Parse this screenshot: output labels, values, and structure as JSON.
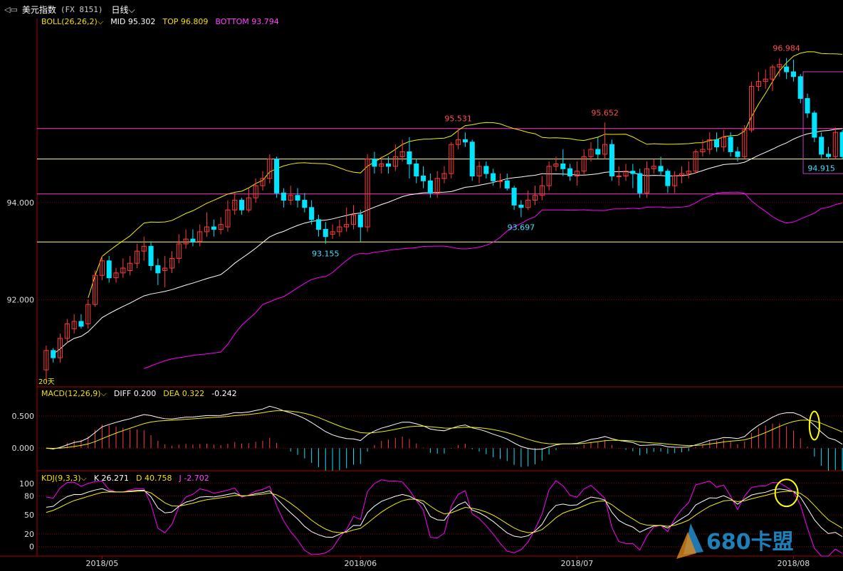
{
  "header": {
    "title": "美元指数",
    "code": "(FX 8151)",
    "period": "日线"
  },
  "colors": {
    "background": "#000000",
    "up": "#ff3b3b",
    "down": "#00e5ff",
    "mid": "#ffffff",
    "top": "#f0f000",
    "bottom": "#ff00ff",
    "hline_magenta": "#ff3cc8",
    "hline_yellow": "#ffff80",
    "grid": "#8a0000"
  },
  "boll": {
    "name": "BOLL(26,26,2)",
    "mid": "MID 95.302",
    "top": "TOP 96.809",
    "bottom": "BOTTOM 93.794"
  },
  "macd": {
    "name": "MACD(12,26,9)",
    "diff": "DIFF 0.200",
    "dea": "DEA 0.322",
    "macd": "-0.242"
  },
  "kdj": {
    "name": "KDJ(9,3,3)",
    "k": "K 26.271",
    "d": "D 40.758",
    "j": "J -2.702"
  },
  "ma_label": "20天",
  "watermark": "680卡盟",
  "chart_data": [
    {
      "type": "candlestick",
      "title": "美元指数 (FX 8151) 日线",
      "x_labels": [
        "2018/05",
        "2018/06",
        "2018/07",
        "2018/08"
      ],
      "y_ticks": [
        94.0,
        92.0
      ],
      "ylim": [
        90.2,
        97.8
      ],
      "annotations": [
        {
          "label": "96.984",
          "value": 96.984,
          "type": "high"
        },
        {
          "label": "95.531",
          "value": 95.531,
          "type": "high"
        },
        {
          "label": "95.652",
          "value": 95.652,
          "type": "high"
        },
        {
          "label": "93.155",
          "value": 93.155,
          "type": "low"
        },
        {
          "label": "93.697",
          "value": 93.697,
          "type": "low"
        },
        {
          "label": "94.915",
          "value": 94.915,
          "type": "low"
        }
      ],
      "horizontal_lines": [
        {
          "value": 95.53,
          "color": "magenta"
        },
        {
          "value": 94.9,
          "color": "yellow"
        },
        {
          "value": 94.18,
          "color": "magenta"
        },
        {
          "value": 93.19,
          "color": "yellow"
        }
      ],
      "candles": [
        [
          90.55,
          90.95,
          91.05,
          90.3
        ],
        [
          90.95,
          90.8,
          91.0,
          90.7
        ],
        [
          90.8,
          91.2,
          91.3,
          90.7
        ],
        [
          91.2,
          91.5,
          91.6,
          91.1
        ],
        [
          91.4,
          91.55,
          91.7,
          91.3
        ],
        [
          91.55,
          91.45,
          91.7,
          91.4
        ],
        [
          91.5,
          91.9,
          92.0,
          91.4
        ],
        [
          91.9,
          92.5,
          92.6,
          91.85
        ],
        [
          92.5,
          92.8,
          92.9,
          92.4
        ],
        [
          92.8,
          92.45,
          92.9,
          92.35
        ],
        [
          92.45,
          92.55,
          92.65,
          92.35
        ],
        [
          92.55,
          92.65,
          92.85,
          92.45
        ],
        [
          92.6,
          92.75,
          92.9,
          92.5
        ],
        [
          92.75,
          93.0,
          93.15,
          92.65
        ],
        [
          93.0,
          93.1,
          93.3,
          92.8
        ],
        [
          93.1,
          92.7,
          93.2,
          92.6
        ],
        [
          92.7,
          92.55,
          92.85,
          92.3
        ],
        [
          92.6,
          92.65,
          92.9,
          92.25
        ],
        [
          92.65,
          92.85,
          93.0,
          92.55
        ],
        [
          92.85,
          93.15,
          93.35,
          92.75
        ],
        [
          93.15,
          93.25,
          93.45,
          93.05
        ],
        [
          93.25,
          93.2,
          93.45,
          93.1
        ],
        [
          93.2,
          93.4,
          93.55,
          93.1
        ],
        [
          93.4,
          93.5,
          93.8,
          93.3
        ],
        [
          93.5,
          93.45,
          93.65,
          93.3
        ],
        [
          93.45,
          93.55,
          93.7,
          93.35
        ],
        [
          93.5,
          93.85,
          94.05,
          93.4
        ],
        [
          93.85,
          94.05,
          94.2,
          93.75
        ],
        [
          94.05,
          93.85,
          94.1,
          93.75
        ],
        [
          93.85,
          94.1,
          94.3,
          93.8
        ],
        [
          94.1,
          94.35,
          94.5,
          94.0
        ],
        [
          94.35,
          94.5,
          94.65,
          94.25
        ],
        [
          94.5,
          94.9,
          95.0,
          94.4
        ],
        [
          94.9,
          94.2,
          94.95,
          94.1
        ],
        [
          94.2,
          94.05,
          94.3,
          93.9
        ],
        [
          94.05,
          94.15,
          94.35,
          93.95
        ],
        [
          94.15,
          94.05,
          94.3,
          93.9
        ],
        [
          94.05,
          93.9,
          94.2,
          93.8
        ],
        [
          93.9,
          93.65,
          94.05,
          93.55
        ],
        [
          93.65,
          93.45,
          93.75,
          93.3
        ],
        [
          93.45,
          93.3,
          93.6,
          93.15
        ],
        [
          93.35,
          93.4,
          93.55,
          93.25
        ],
        [
          93.4,
          93.5,
          93.65,
          93.3
        ],
        [
          93.5,
          93.55,
          93.9,
          93.4
        ],
        [
          93.55,
          93.75,
          93.95,
          93.45
        ],
        [
          93.75,
          93.5,
          93.85,
          93.2
        ],
        [
          93.5,
          94.9,
          95.0,
          93.4
        ],
        [
          94.9,
          94.75,
          95.05,
          94.6
        ],
        [
          94.75,
          94.8,
          94.95,
          94.6
        ],
        [
          94.8,
          94.75,
          94.95,
          94.6
        ],
        [
          94.75,
          94.95,
          95.2,
          94.65
        ],
        [
          94.95,
          95.05,
          95.3,
          94.85
        ],
        [
          95.05,
          94.8,
          95.35,
          94.5
        ],
        [
          94.8,
          94.55,
          94.9,
          94.4
        ],
        [
          94.55,
          94.45,
          94.75,
          94.3
        ],
        [
          94.45,
          94.2,
          94.6,
          94.1
        ],
        [
          94.2,
          94.5,
          94.65,
          94.1
        ],
        [
          94.5,
          94.6,
          94.75,
          94.4
        ],
        [
          94.6,
          95.2,
          95.25,
          94.5
        ],
        [
          95.2,
          95.3,
          95.53,
          95.1
        ],
        [
          95.3,
          95.25,
          95.45,
          95.15
        ],
        [
          95.25,
          94.55,
          95.3,
          94.45
        ],
        [
          94.55,
          94.75,
          94.85,
          94.4
        ],
        [
          94.75,
          94.6,
          94.85,
          94.5
        ],
        [
          94.6,
          94.45,
          94.7,
          94.35
        ],
        [
          94.45,
          94.45,
          94.6,
          94.3
        ],
        [
          94.45,
          94.3,
          94.6,
          94.25
        ],
        [
          94.3,
          93.95,
          94.35,
          93.85
        ],
        [
          93.95,
          93.9,
          94.05,
          93.7
        ],
        [
          93.9,
          94.05,
          94.25,
          93.85
        ],
        [
          94.05,
          94.15,
          94.35,
          93.95
        ],
        [
          94.15,
          94.35,
          94.55,
          94.05
        ],
        [
          94.35,
          94.75,
          94.85,
          94.25
        ],
        [
          94.75,
          94.8,
          94.95,
          94.65
        ],
        [
          94.8,
          94.7,
          95.1,
          94.55
        ],
        [
          94.7,
          94.55,
          94.8,
          94.45
        ],
        [
          94.55,
          94.65,
          94.85,
          94.35
        ],
        [
          94.65,
          94.95,
          95.1,
          94.55
        ],
        [
          94.95,
          95.1,
          95.25,
          94.85
        ],
        [
          95.1,
          95.0,
          95.35,
          94.9
        ],
        [
          95.0,
          95.2,
          95.652,
          94.9
        ],
        [
          95.2,
          94.55,
          95.3,
          94.45
        ],
        [
          94.55,
          94.55,
          94.75,
          94.35
        ],
        [
          94.55,
          94.65,
          94.8,
          94.45
        ],
        [
          94.65,
          94.6,
          94.8,
          94.3
        ],
        [
          94.6,
          94.2,
          94.7,
          94.1
        ],
        [
          94.2,
          94.7,
          94.85,
          94.1
        ],
        [
          94.7,
          94.75,
          94.9,
          94.6
        ],
        [
          94.75,
          94.65,
          94.95,
          94.55
        ],
        [
          94.65,
          94.35,
          94.7,
          94.2
        ],
        [
          94.35,
          94.55,
          94.65,
          94.2
        ],
        [
          94.55,
          94.6,
          94.75,
          94.4
        ],
        [
          94.6,
          94.65,
          94.85,
          94.5
        ],
        [
          94.65,
          95.05,
          95.1,
          94.6
        ],
        [
          95.05,
          95.1,
          95.3,
          94.95
        ],
        [
          95.1,
          95.3,
          95.45,
          95.0
        ],
        [
          95.3,
          95.15,
          95.45,
          95.05
        ],
        [
          95.15,
          95.35,
          95.5,
          95.05
        ],
        [
          95.35,
          95.05,
          95.45,
          94.95
        ],
        [
          95.05,
          94.95,
          95.15,
          94.85
        ],
        [
          94.95,
          95.5,
          95.6,
          94.9
        ],
        [
          95.5,
          96.4,
          96.5,
          95.45
        ],
        [
          96.4,
          96.5,
          96.7,
          96.3
        ],
        [
          96.5,
          96.55,
          96.75,
          96.35
        ],
        [
          96.55,
          96.8,
          96.85,
          96.3
        ],
        [
          96.8,
          96.85,
          96.98,
          96.6
        ],
        [
          96.8,
          96.7,
          96.984,
          96.55
        ],
        [
          96.7,
          96.6,
          96.95,
          96.5
        ],
        [
          96.6,
          96.15,
          96.65,
          96.05
        ],
        [
          96.15,
          95.85,
          96.25,
          95.75
        ],
        [
          95.85,
          95.35,
          95.9,
          95.25
        ],
        [
          95.35,
          95.0,
          95.45,
          94.915
        ],
        [
          95.0,
          94.95,
          95.15,
          94.9
        ],
        [
          94.95,
          95.45,
          95.55,
          94.9
        ],
        [
          95.45,
          94.95,
          95.5,
          94.9
        ]
      ],
      "series": [
        {
          "name": "BOLL(26,26,2)"
        }
      ]
    },
    {
      "type": "line",
      "title": "MACD(12,26,9)",
      "y_ticks": [
        0.5,
        0.0
      ],
      "ylim": [
        -0.35,
        0.95
      ],
      "series": [
        {
          "name": "DIFF"
        },
        {
          "name": "DEA"
        },
        {
          "name": "MACD"
        }
      ]
    },
    {
      "type": "line",
      "title": "KDJ(9,3,3)",
      "y_ticks": [
        100,
        80,
        50,
        20,
        0
      ],
      "ylim": [
        -15,
        120
      ],
      "series": [
        {
          "name": "K"
        },
        {
          "name": "D"
        },
        {
          "name": "J"
        }
      ]
    }
  ]
}
